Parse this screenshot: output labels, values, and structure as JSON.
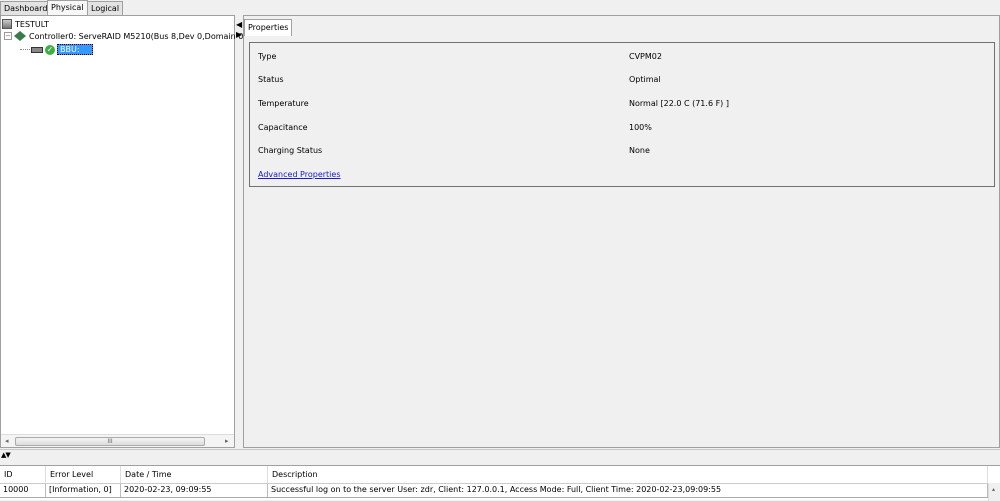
{
  "tabs": [
    "Dashboard",
    "Physical",
    "Logical"
  ],
  "tree": {
    "root": "TESTULT",
    "controller": "Controller0: ServeRAID M5210(Bus 8,Dev 0,Domain 0",
    "bbu": "BBU:"
  },
  "scroll_grip": "III",
  "properties": {
    "tab": "Properties",
    "rows": [
      {
        "label": "Type",
        "value": "CVPM02"
      },
      {
        "label": "Status",
        "value": "Optimal"
      },
      {
        "label": "Temperature",
        "value": "Normal [22.0 C (71.6 F) ]"
      },
      {
        "label": "Capacitance",
        "value": "100%"
      },
      {
        "label": "Charging Status",
        "value": "None"
      }
    ],
    "advanced_link": "Advanced Properties"
  },
  "log": {
    "columns": [
      "ID",
      "Error Level",
      "Date / Time",
      "Description"
    ],
    "rows": [
      [
        "10000",
        "[Information, 0]",
        "2020-02-23, 09:09:55",
        "Successful log on to the server User:  zdr, Client:  127.0.0.1,    Access Mode:  Full, Client Time:  2020-02-23,09:09:55"
      ]
    ]
  }
}
